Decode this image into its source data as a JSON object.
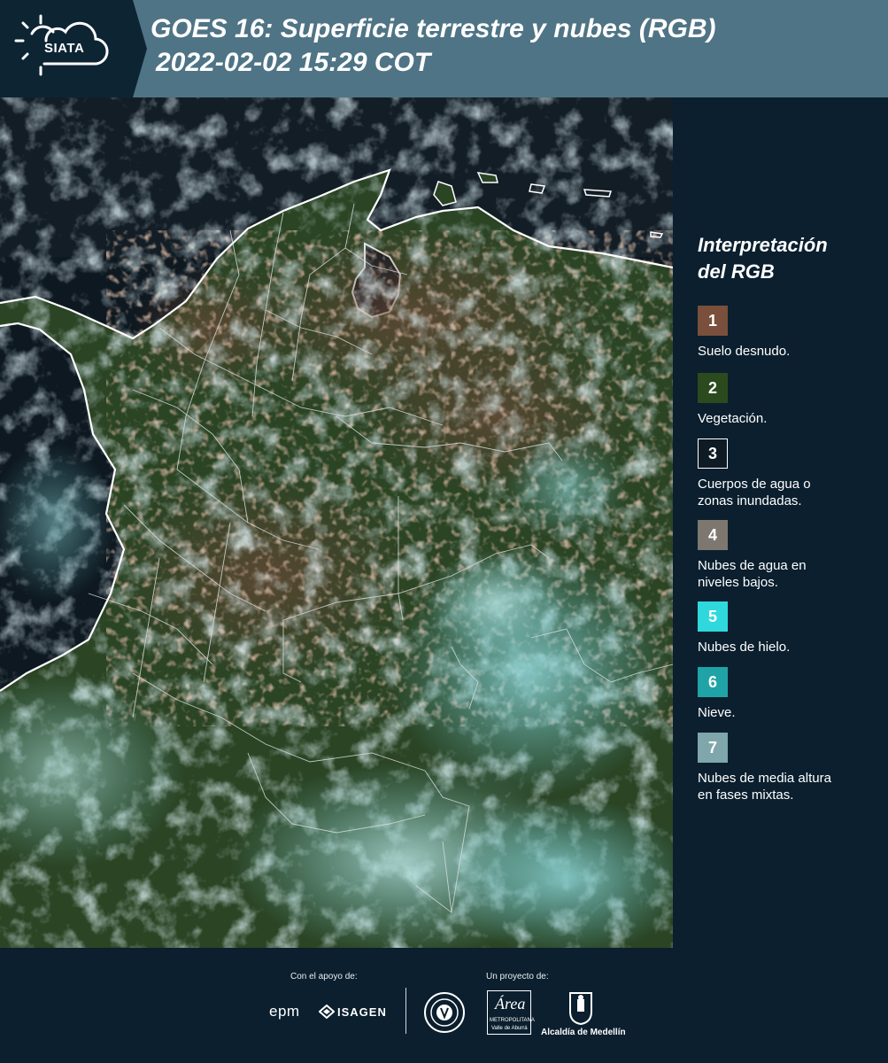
{
  "header": {
    "logo_text": "SIATA",
    "title_line1": "GOES 16: Superficie terrestre y nubes (RGB)",
    "title_line2": "2022-02-02 15:29 COT"
  },
  "legend": {
    "title_line1": "Interpretación",
    "title_line2": "del RGB",
    "items": [
      {
        "number": "1",
        "color": "#7a4f3b",
        "border": "#7a4f3b",
        "line1": "Suelo desnudo.",
        "line2": ""
      },
      {
        "number": "2",
        "color": "#2b4a1e",
        "border": "#2b4a1e",
        "line1": "Vegetación.",
        "line2": ""
      },
      {
        "number": "3",
        "color": "#0e1a24",
        "border": "#ffffff",
        "line1": "Cuerpos de agua o",
        "line2": "zonas inundadas."
      },
      {
        "number": "4",
        "color": "#7d7770",
        "border": "#7d7770",
        "line1": "Nubes de agua en",
        "line2": "niveles bajos."
      },
      {
        "number": "5",
        "color": "#2fd8dc",
        "border": "#2fd8dc",
        "line1": "Nubes de hielo.",
        "line2": ""
      },
      {
        "number": "6",
        "color": "#1fa3a6",
        "border": "#1fa3a6",
        "line1": "Nieve.",
        "line2": ""
      },
      {
        "number": "7",
        "color": "#7fa6aa",
        "border": "#7fa6aa",
        "line1": "Nubes de media altura",
        "line2": "en fases mixtas."
      }
    ]
  },
  "footer": {
    "support_label": "Con el apoyo de:",
    "project_label": "Un proyecto de:",
    "sponsor_epm": "epm",
    "sponsor_isagen": "ISAGEN",
    "area_caption_1": "METROPOLITANA",
    "area_caption_2": "Valle de Aburrá",
    "area_script": "Área",
    "alcaldia": "Alcaldía de Medellín"
  }
}
